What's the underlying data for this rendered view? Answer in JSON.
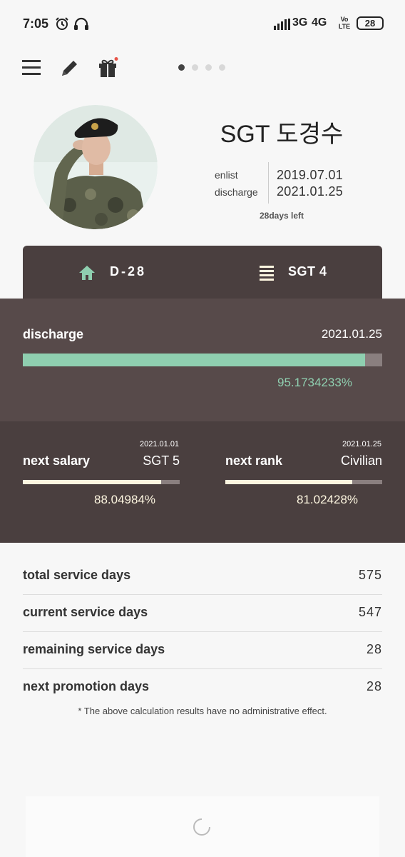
{
  "status_bar": {
    "time": "7:05",
    "net_3g": "3G",
    "net_4g": "4G",
    "volte": "Vo LTE",
    "battery": "28",
    "icons": [
      "alarm-icon",
      "headphones-icon",
      "signal-icon"
    ]
  },
  "toolbar": {
    "icons": [
      "menu-icon",
      "edit-icon",
      "gift-icon"
    ],
    "page_dots": 4,
    "active_dot": 0,
    "gift_badge_color": "#e8564a"
  },
  "profile": {
    "name": "SGT 도경수",
    "enlist_label": "enlist",
    "enlist_date": "2019.07.01",
    "discharge_label": "discharge",
    "discharge_date": "2021.01.25",
    "days_left": "28days left"
  },
  "tabs": {
    "dday": "D-28",
    "rank": "SGT 4"
  },
  "discharge": {
    "label": "discharge",
    "date": "2021.01.25",
    "percent_text": "95.1734233%",
    "progress": 0.951734233
  },
  "next_salary": {
    "label": "next salary",
    "date": "2021.01.01",
    "value": "SGT 5",
    "percent_text": "88.04984%",
    "progress": 0.8804984
  },
  "next_rank": {
    "label": "next rank",
    "date": "2021.01.25",
    "value": "Civilian",
    "percent_text": "81.02428%",
    "progress": 0.8102428
  },
  "stats": [
    {
      "label": "total service days",
      "value": "575"
    },
    {
      "label": "current service days",
      "value": "547"
    },
    {
      "label": "remaining service days",
      "value": "28"
    },
    {
      "label": "next promotion days",
      "value": "28"
    }
  ],
  "note": "* The above calculation results have no administrative effect.",
  "colors": {
    "accent_green": "#8fcfb0",
    "cream": "#fdf6e0",
    "dark_brown": "#4a3f3f",
    "mid_brown": "#574a4a"
  }
}
